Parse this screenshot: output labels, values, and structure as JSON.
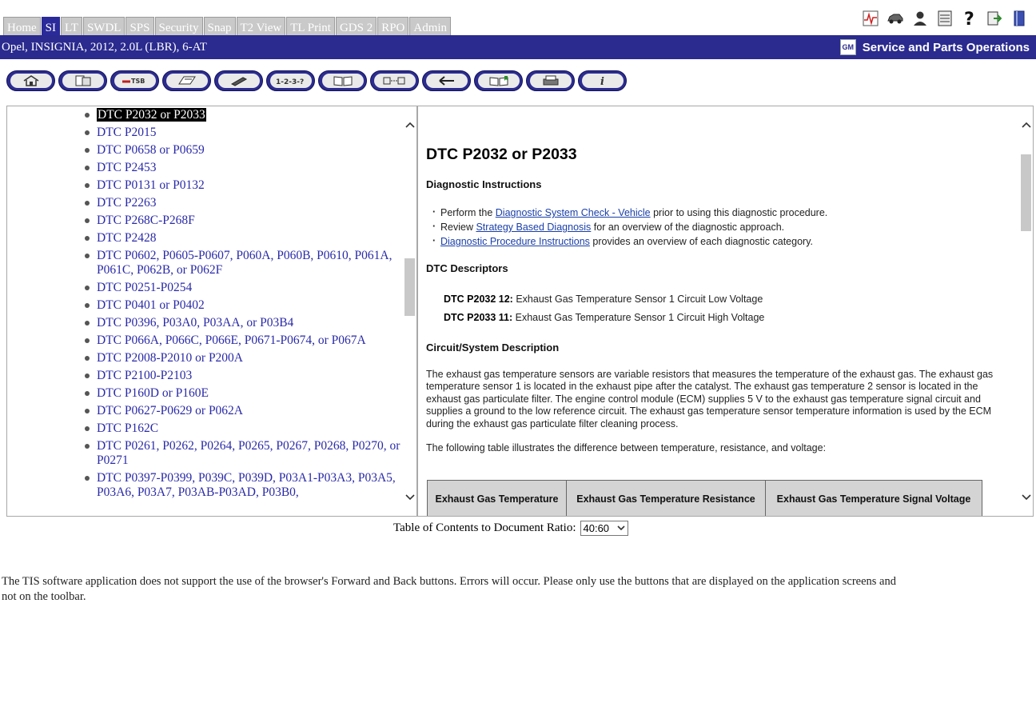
{
  "tabs": [
    {
      "label": "Home",
      "active": false
    },
    {
      "label": "SI",
      "active": true
    },
    {
      "label": "LT",
      "active": false
    },
    {
      "label": "SWDL",
      "active": false
    },
    {
      "label": "SPS",
      "active": false
    },
    {
      "label": "Security",
      "active": false
    },
    {
      "label": "Snap",
      "active": false
    },
    {
      "label": "T2 View",
      "active": false
    },
    {
      "label": "TL Print",
      "active": false
    },
    {
      "label": "GDS 2",
      "active": false
    },
    {
      "label": "RPO",
      "active": false
    },
    {
      "label": "Admin",
      "active": false
    }
  ],
  "top_icons": [
    "graph-icon",
    "car-icon",
    "user-icon",
    "calculator-icon",
    "help-icon",
    "export-icon",
    "book-icon"
  ],
  "header": {
    "vehicle": "Opel, INSIGNIA, 2012, 2.0L (LBR), 6-AT",
    "gm_logo": "GM",
    "org": "Service and Parts Operations"
  },
  "toolbar": {
    "buttons": [
      {
        "name": "home-button",
        "icon": "house-icon",
        "text": ""
      },
      {
        "name": "documents-button",
        "icon": "documents-icon",
        "text": ""
      },
      {
        "name": "tsb-button",
        "icon": "tsb-icon",
        "text": "TSB"
      },
      {
        "name": "manual-button",
        "icon": "manual-icon",
        "text": ""
      },
      {
        "name": "tool-button",
        "icon": "tool-icon",
        "text": ""
      },
      {
        "name": "steps-button",
        "icon": "steps-icon",
        "text": "1-2-3-?"
      },
      {
        "name": "open-book-button",
        "icon": "open-book-icon",
        "text": ""
      },
      {
        "name": "connector-button",
        "icon": "connector-icon",
        "text": ""
      },
      {
        "name": "back-button",
        "icon": "back-arrow-icon",
        "text": ""
      },
      {
        "name": "bookmark-button",
        "icon": "bookmark-icon",
        "text": ""
      },
      {
        "name": "print-button",
        "icon": "printer-icon",
        "text": ""
      },
      {
        "name": "info-button",
        "icon": "info-icon",
        "text": "i"
      }
    ]
  },
  "toc": {
    "items": [
      {
        "label": "DTC P2032 or P2033",
        "selected": true
      },
      {
        "label": "DTC P2015",
        "selected": false
      },
      {
        "label": "DTC P0658 or P0659",
        "selected": false
      },
      {
        "label": "DTC P2453",
        "selected": false
      },
      {
        "label": "DTC P0131 or P0132",
        "selected": false
      },
      {
        "label": "DTC P2263",
        "selected": false
      },
      {
        "label": "DTC P268C-P268F",
        "selected": false
      },
      {
        "label": "DTC P2428",
        "selected": false
      },
      {
        "label": "DTC P0602, P0605-P0607, P060A, P060B, P0610, P061A, P061C, P062B, or P062F",
        "selected": false
      },
      {
        "label": "DTC P0251-P0254",
        "selected": false
      },
      {
        "label": "DTC P0401 or P0402",
        "selected": false
      },
      {
        "label": "DTC P0396, P03A0, P03AA, or P03B4",
        "selected": false
      },
      {
        "label": "DTC P066A, P066C, P066E, P0671-P0674, or P067A",
        "selected": false
      },
      {
        "label": "DTC P2008-P2010 or P200A",
        "selected": false
      },
      {
        "label": "DTC P2100-P2103",
        "selected": false
      },
      {
        "label": "DTC P160D or P160E",
        "selected": false
      },
      {
        "label": "DTC P0627-P0629 or P062A",
        "selected": false
      },
      {
        "label": "DTC P162C",
        "selected": false
      },
      {
        "label": "DTC P0261, P0262, P0264, P0265, P0267, P0268, P0270, or P0271",
        "selected": false
      },
      {
        "label": "DTC P0397-P0399, P039C, P039D, P03A1-P03A3, P03A5, P03A6, P03A7, P03AB-P03AD, P03B0,",
        "selected": false
      }
    ],
    "scroll_position": 0.42
  },
  "doc": {
    "title": "DTC P2032 or P2033",
    "diag_heading": "Diagnostic Instructions",
    "bullets": [
      {
        "pre": "Perform the ",
        "link": "Diagnostic System Check - Vehicle",
        "post": " prior to using this diagnostic procedure."
      },
      {
        "pre": "Review ",
        "link": "Strategy Based Diagnosis",
        "post": " for an overview of the diagnostic approach."
      },
      {
        "pre": "",
        "link": "Diagnostic Procedure Instructions",
        "post": " provides an overview of each diagnostic category."
      }
    ],
    "descriptors_heading": "DTC Descriptors",
    "descriptors": [
      {
        "code": "DTC P2032 12:",
        "text": " Exhaust Gas Temperature Sensor 1 Circuit Low Voltage"
      },
      {
        "code": "DTC P2033 11:",
        "text": " Exhaust Gas Temperature Sensor 1 Circuit High Voltage"
      }
    ],
    "circuit_heading": "Circuit/System Description",
    "circuit_text": "The exhaust gas temperature sensors are variable resistors that measures the temperature of the exhaust gas. The exhaust gas temperature sensor 1 is located in the exhaust pipe after the catalyst. The exhaust gas temperature 2 sensor is located in the exhaust gas particulate filter. The engine control module (ECM) supplies 5 V to the exhaust gas temperature signal circuit and supplies a ground to the low reference circuit. The exhaust gas temperature sensor temperature information is used by the ECM during the exhaust gas particulate filter cleaning process.",
    "table_intro": "The following table illustrates the difference between temperature, resistance, and voltage:",
    "table_headers": [
      "Exhaust Gas Temperature",
      "Exhaust Gas Temperature Resistance",
      "Exhaust Gas Temperature Signal Voltage"
    ],
    "scroll_position": 0.08
  },
  "ratio": {
    "label": "Table of Contents to Document Ratio:",
    "value": "40:60"
  },
  "notice": "The TIS software application does not support the use of the browser's Forward and Back buttons. Errors will occur. Please only use the buttons that are displayed on the application screens and not on the toolbar.",
  "colors": {
    "header_blue": "#2a2a8f",
    "link_blue": "#2a2aa8",
    "tab_inactive": "#c9c9c9",
    "tab_active": "#2a2a9a"
  }
}
